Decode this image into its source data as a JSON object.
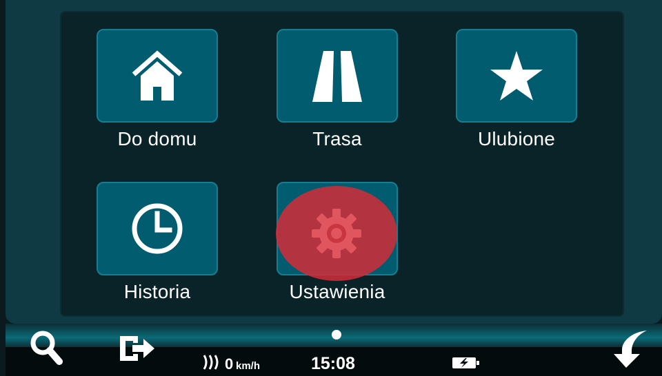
{
  "menu": {
    "items": [
      {
        "label": "Do domu",
        "icon": "home-icon"
      },
      {
        "label": "Trasa",
        "icon": "road-icon"
      },
      {
        "label": "Ulubione",
        "icon": "star-icon"
      },
      {
        "label": "Historia",
        "icon": "clock-icon"
      },
      {
        "label": "Ustawienia",
        "icon": "gear-icon"
      }
    ]
  },
  "statusbar": {
    "speed_value": "0",
    "speed_unit": "km/h",
    "time": "15:08",
    "page_indicator": "page-dot",
    "left_icons": [
      "search-icon",
      "exit-icon"
    ],
    "right_icon": "back-arrow-icon",
    "status_icons": [
      "gps-signal-icon",
      "battery-charging-icon"
    ]
  },
  "colors": {
    "tile_fill": "#005c6e",
    "tile_border": "#157f91",
    "panel": "#0a2329",
    "frame": "#0f3a43",
    "tap_marker": "#d22c38"
  }
}
